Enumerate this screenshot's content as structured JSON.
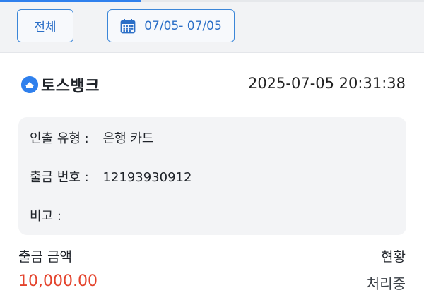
{
  "filter": {
    "all_label": "전체",
    "date_range_label": "07/05- 07/05",
    "calendar_icon": "calendar-icon"
  },
  "transaction": {
    "bank_name": "토스뱅크",
    "bank_logo_icon": "toss-bank-logo-icon",
    "timestamp": "2025-07-05 20:31:38",
    "details": {
      "type_label": "인출 유형 :",
      "type_value": "은행 카드",
      "number_label": "출금 번호 :",
      "number_value": "12193930912",
      "memo_label": "비고 :",
      "memo_value": ""
    },
    "amount_label": "출금 금액",
    "amount_value": "10,000.00",
    "status_label": "현황",
    "status_value": "처리중"
  },
  "colors": {
    "accent": "#2f80ed",
    "amount": "#e4432c"
  }
}
